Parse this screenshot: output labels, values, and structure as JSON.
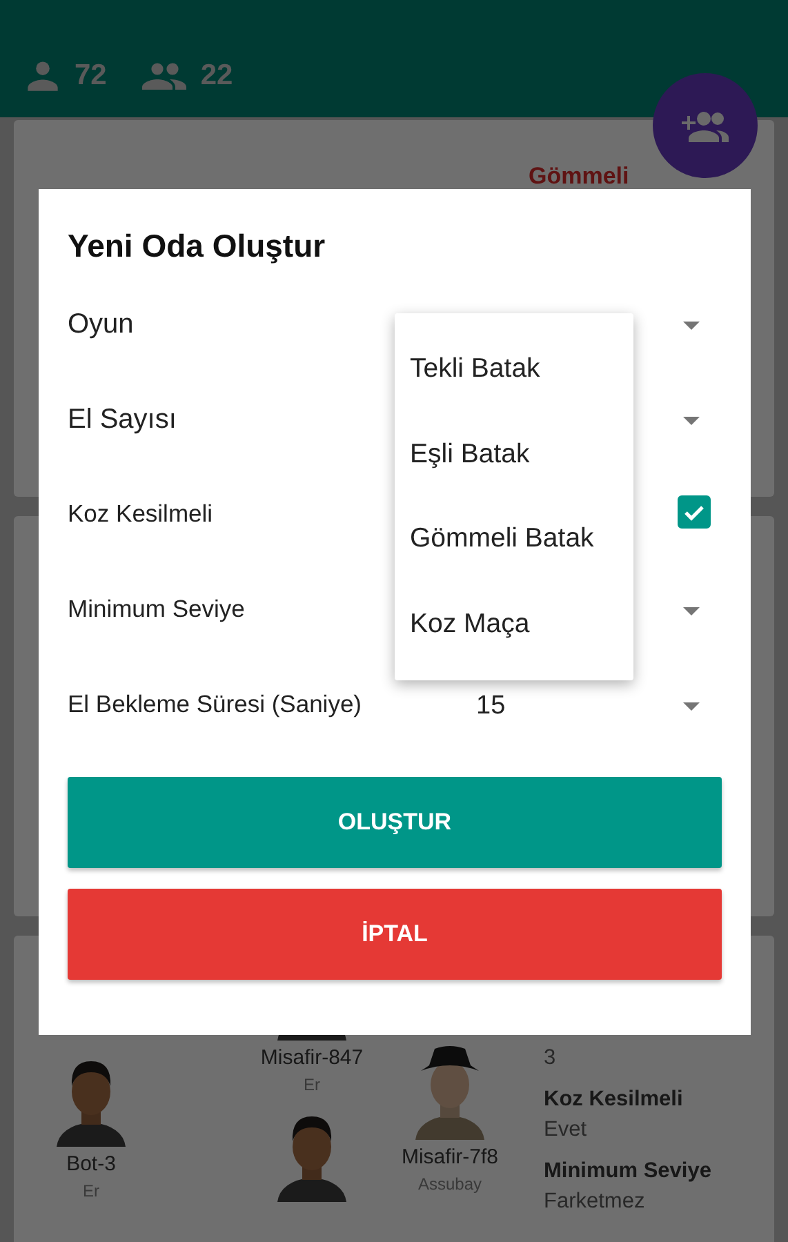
{
  "header": {
    "online_users": "72",
    "tables": "22"
  },
  "background_card": {
    "game": "Gömmeli",
    "players": [
      {
        "name": "Bot-3",
        "rank": "Er"
      },
      {
        "name": "Misafir-847",
        "rank": "Er"
      },
      {
        "name": "Misafir-7f8",
        "rank": "Assubay"
      }
    ],
    "details": [
      {
        "value": "3"
      },
      {
        "label": "Koz Kesilmeli",
        "value": "Evet"
      },
      {
        "label": "Minimum Seviye",
        "value": "Farketmez"
      }
    ]
  },
  "dialog": {
    "title": "Yeni Oda Oluştur",
    "fields": [
      {
        "kind": "select",
        "label": "Oyun"
      },
      {
        "kind": "select",
        "label": "El Sayısı"
      },
      {
        "kind": "checkbox",
        "label": "Koz Kesilmeli",
        "checked": true
      },
      {
        "kind": "select",
        "label": "Minimum Seviye"
      },
      {
        "kind": "select",
        "label": "El Bekleme Süresi (Saniye)",
        "value": "15"
      }
    ],
    "buttons": [
      {
        "kind": "primary",
        "label": "OLUŞTUR"
      },
      {
        "kind": "danger",
        "label": "İPTAL"
      }
    ],
    "dropdown": {
      "options": [
        "Tekli Batak",
        "Eşli Batak",
        "Gömmeli Batak",
        "Koz Maça"
      ]
    }
  }
}
